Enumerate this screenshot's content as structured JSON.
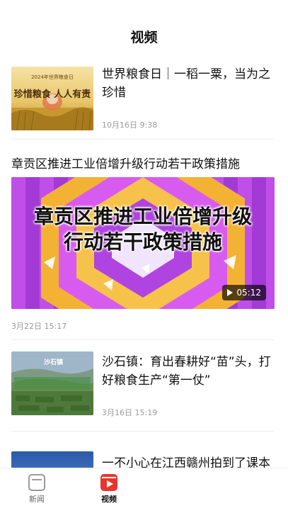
{
  "header": {
    "title": "视频"
  },
  "feed": {
    "item1": {
      "title": "世界粮食日｜一稻一粟，当为之珍惜",
      "time": "10月16日 9:38",
      "thumb_caption_top": "2024年世界粮食日",
      "thumb_caption": "珍惜粮食 人人有责"
    },
    "item2": {
      "title": "章贡区推进工业倍增升级行动若干政策措施",
      "overlay_line1": "章贡区推进工业倍增升级",
      "overlay_line2": "行动若干政策措施",
      "duration": "05:12",
      "time": "3月22日 15:17"
    },
    "item3": {
      "title": "沙石镇：育出春耕好“苗”头，打好粮食生产“第一仗”",
      "time": "3月16日 15:19",
      "thumb_tag": "沙石镇"
    },
    "item4": {
      "title": "一不小心在江西赣州拍到了课本封面   I accidentally ph"
    }
  },
  "tabbar": {
    "tabs": [
      {
        "label": "新闻",
        "icon": "news-icon"
      },
      {
        "label": "视频",
        "icon": "video-icon"
      }
    ],
    "active_color": "#e8342f",
    "inactive_color": "#666666"
  }
}
